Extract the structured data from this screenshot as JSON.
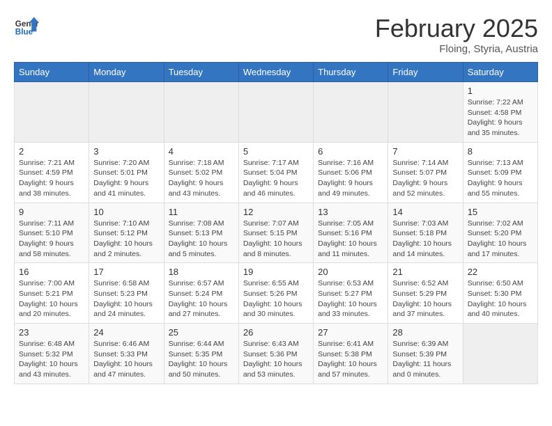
{
  "header": {
    "logo_general": "General",
    "logo_blue": "Blue",
    "month_title": "February 2025",
    "location": "Floing, Styria, Austria"
  },
  "days_of_week": [
    "Sunday",
    "Monday",
    "Tuesday",
    "Wednesday",
    "Thursday",
    "Friday",
    "Saturday"
  ],
  "weeks": [
    [
      {
        "day": "",
        "info": ""
      },
      {
        "day": "",
        "info": ""
      },
      {
        "day": "",
        "info": ""
      },
      {
        "day": "",
        "info": ""
      },
      {
        "day": "",
        "info": ""
      },
      {
        "day": "",
        "info": ""
      },
      {
        "day": "1",
        "info": "Sunrise: 7:22 AM\nSunset: 4:58 PM\nDaylight: 9 hours and 35 minutes."
      }
    ],
    [
      {
        "day": "2",
        "info": "Sunrise: 7:21 AM\nSunset: 4:59 PM\nDaylight: 9 hours and 38 minutes."
      },
      {
        "day": "3",
        "info": "Sunrise: 7:20 AM\nSunset: 5:01 PM\nDaylight: 9 hours and 41 minutes."
      },
      {
        "day": "4",
        "info": "Sunrise: 7:18 AM\nSunset: 5:02 PM\nDaylight: 9 hours and 43 minutes."
      },
      {
        "day": "5",
        "info": "Sunrise: 7:17 AM\nSunset: 5:04 PM\nDaylight: 9 hours and 46 minutes."
      },
      {
        "day": "6",
        "info": "Sunrise: 7:16 AM\nSunset: 5:06 PM\nDaylight: 9 hours and 49 minutes."
      },
      {
        "day": "7",
        "info": "Sunrise: 7:14 AM\nSunset: 5:07 PM\nDaylight: 9 hours and 52 minutes."
      },
      {
        "day": "8",
        "info": "Sunrise: 7:13 AM\nSunset: 5:09 PM\nDaylight: 9 hours and 55 minutes."
      }
    ],
    [
      {
        "day": "9",
        "info": "Sunrise: 7:11 AM\nSunset: 5:10 PM\nDaylight: 9 hours and 58 minutes."
      },
      {
        "day": "10",
        "info": "Sunrise: 7:10 AM\nSunset: 5:12 PM\nDaylight: 10 hours and 2 minutes."
      },
      {
        "day": "11",
        "info": "Sunrise: 7:08 AM\nSunset: 5:13 PM\nDaylight: 10 hours and 5 minutes."
      },
      {
        "day": "12",
        "info": "Sunrise: 7:07 AM\nSunset: 5:15 PM\nDaylight: 10 hours and 8 minutes."
      },
      {
        "day": "13",
        "info": "Sunrise: 7:05 AM\nSunset: 5:16 PM\nDaylight: 10 hours and 11 minutes."
      },
      {
        "day": "14",
        "info": "Sunrise: 7:03 AM\nSunset: 5:18 PM\nDaylight: 10 hours and 14 minutes."
      },
      {
        "day": "15",
        "info": "Sunrise: 7:02 AM\nSunset: 5:20 PM\nDaylight: 10 hours and 17 minutes."
      }
    ],
    [
      {
        "day": "16",
        "info": "Sunrise: 7:00 AM\nSunset: 5:21 PM\nDaylight: 10 hours and 20 minutes."
      },
      {
        "day": "17",
        "info": "Sunrise: 6:58 AM\nSunset: 5:23 PM\nDaylight: 10 hours and 24 minutes."
      },
      {
        "day": "18",
        "info": "Sunrise: 6:57 AM\nSunset: 5:24 PM\nDaylight: 10 hours and 27 minutes."
      },
      {
        "day": "19",
        "info": "Sunrise: 6:55 AM\nSunset: 5:26 PM\nDaylight: 10 hours and 30 minutes."
      },
      {
        "day": "20",
        "info": "Sunrise: 6:53 AM\nSunset: 5:27 PM\nDaylight: 10 hours and 33 minutes."
      },
      {
        "day": "21",
        "info": "Sunrise: 6:52 AM\nSunset: 5:29 PM\nDaylight: 10 hours and 37 minutes."
      },
      {
        "day": "22",
        "info": "Sunrise: 6:50 AM\nSunset: 5:30 PM\nDaylight: 10 hours and 40 minutes."
      }
    ],
    [
      {
        "day": "23",
        "info": "Sunrise: 6:48 AM\nSunset: 5:32 PM\nDaylight: 10 hours and 43 minutes."
      },
      {
        "day": "24",
        "info": "Sunrise: 6:46 AM\nSunset: 5:33 PM\nDaylight: 10 hours and 47 minutes."
      },
      {
        "day": "25",
        "info": "Sunrise: 6:44 AM\nSunset: 5:35 PM\nDaylight: 10 hours and 50 minutes."
      },
      {
        "day": "26",
        "info": "Sunrise: 6:43 AM\nSunset: 5:36 PM\nDaylight: 10 hours and 53 minutes."
      },
      {
        "day": "27",
        "info": "Sunrise: 6:41 AM\nSunset: 5:38 PM\nDaylight: 10 hours and 57 minutes."
      },
      {
        "day": "28",
        "info": "Sunrise: 6:39 AM\nSunset: 5:39 PM\nDaylight: 11 hours and 0 minutes."
      },
      {
        "day": "",
        "info": ""
      }
    ]
  ]
}
